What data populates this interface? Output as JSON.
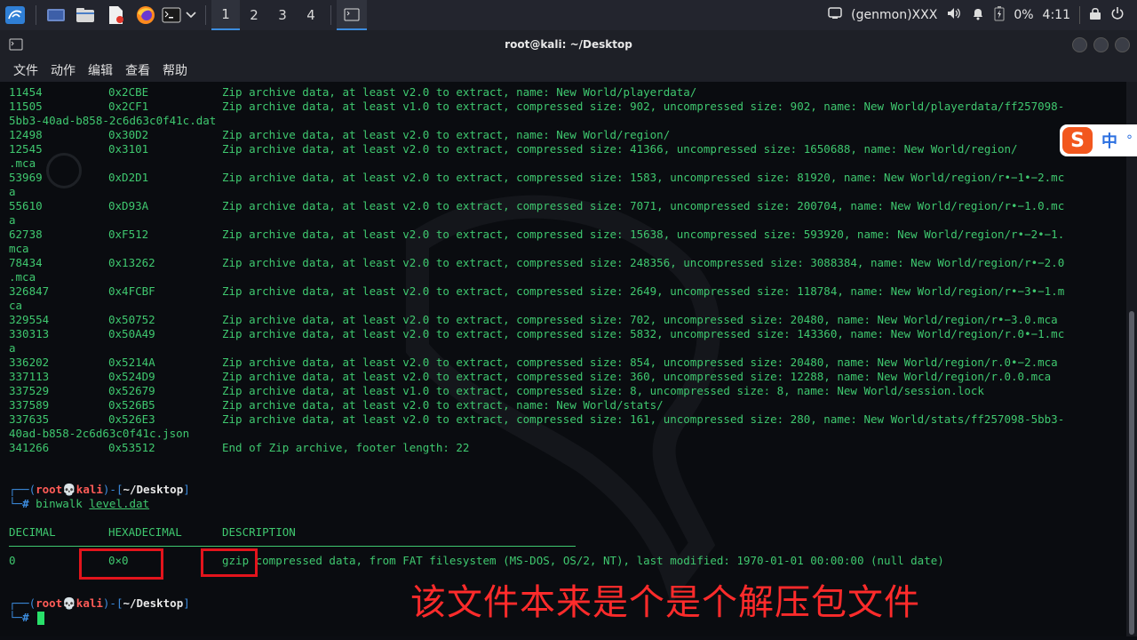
{
  "panel": {
    "workspaces": [
      "1",
      "2",
      "3",
      "4"
    ],
    "genmon": "(genmon)XXX",
    "battery": "0%",
    "clock": "4:11"
  },
  "window": {
    "title": "root@kali: ~/Desktop",
    "menu": [
      "文件",
      "动作",
      "编辑",
      "查看",
      "帮助"
    ]
  },
  "binwalk_rows": [
    {
      "dec": "11454",
      "hex": "0x2CBE",
      "desc": "Zip archive data, at least v2.0 to extract, name: New World/playerdata/"
    },
    {
      "dec": "11505",
      "hex": "0x2CF1",
      "desc": "Zip archive data, at least v1.0 to extract, compressed size: 902, uncompressed size: 902, name: New World/playerdata/ff257098-",
      "wrap": "5bb3-40ad-b858-2c6d63c0f41c.dat"
    },
    {
      "dec": "12498",
      "hex": "0x30D2",
      "desc": "Zip archive data, at least v2.0 to extract, name: New World/region/"
    },
    {
      "dec": "12545",
      "hex": "0x3101",
      "desc": "Zip archive data, at least v2.0 to extract, compressed size: 41366, uncompressed size: 1650688, name: New World/region/",
      "wrap": ".mca"
    },
    {
      "dec": "53969",
      "hex": "0xD2D1",
      "desc": "Zip archive data, at least v2.0 to extract, compressed size: 1583, uncompressed size: 81920, name: New World/region/r•−1•−2.mc",
      "wrap": "a"
    },
    {
      "dec": "55610",
      "hex": "0xD93A",
      "desc": "Zip archive data, at least v2.0 to extract, compressed size: 7071, uncompressed size: 200704, name: New World/region/r•−1.0.mc",
      "wrap": "a"
    },
    {
      "dec": "62738",
      "hex": "0xF512",
      "desc": "Zip archive data, at least v2.0 to extract, compressed size: 15638, uncompressed size: 593920, name: New World/region/r•−2•−1.",
      "wrap": "mca"
    },
    {
      "dec": "78434",
      "hex": "0x13262",
      "desc": "Zip archive data, at least v2.0 to extract, compressed size: 248356, uncompressed size: 3088384, name: New World/region/r•−2.0",
      "wrap": ".mca"
    },
    {
      "dec": "326847",
      "hex": "0x4FCBF",
      "desc": "Zip archive data, at least v2.0 to extract, compressed size: 2649, uncompressed size: 118784, name: New World/region/r•−3•−1.m",
      "wrap": "ca"
    },
    {
      "dec": "329554",
      "hex": "0x50752",
      "desc": "Zip archive data, at least v2.0 to extract, compressed size: 702, uncompressed size: 20480, name: New World/region/r•−3.0.mca"
    },
    {
      "dec": "330313",
      "hex": "0x50A49",
      "desc": "Zip archive data, at least v2.0 to extract, compressed size: 5832, uncompressed size: 143360, name: New World/region/r.0•−1.mc",
      "wrap": "a"
    },
    {
      "dec": "336202",
      "hex": "0x5214A",
      "desc": "Zip archive data, at least v2.0 to extract, compressed size: 854, uncompressed size: 20480, name: New World/region/r.0•−2.mca"
    },
    {
      "dec": "337113",
      "hex": "0x524D9",
      "desc": "Zip archive data, at least v2.0 to extract, compressed size: 360, uncompressed size: 12288, name: New World/region/r.0.0.mca"
    },
    {
      "dec": "337529",
      "hex": "0x52679",
      "desc": "Zip archive data, at least v1.0 to extract, compressed size: 8, uncompressed size: 8, name: New World/session.lock"
    },
    {
      "dec": "337589",
      "hex": "0x526B5",
      "desc": "Zip archive data, at least v2.0 to extract, name: New World/stats/"
    },
    {
      "dec": "337635",
      "hex": "0x526E3",
      "desc": "Zip archive data, at least v2.0 to extract, compressed size: 161, uncompressed size: 280, name: New World/stats/ff257098-5bb3-",
      "wrap": "40ad-b858-2c6d63c0f41c.json"
    },
    {
      "dec": "341266",
      "hex": "0x53512",
      "desc": "End of Zip archive, footer length: 22"
    }
  ],
  "prompt": {
    "user": "root",
    "host": "kali",
    "dir": "~/Desktop",
    "command": "binwalk",
    "arg": "level.dat"
  },
  "result": {
    "h_dec": "DECIMAL",
    "h_hex": "HEXADECIMAL",
    "h_desc": "DESCRIPTION",
    "dec": "0",
    "hex": "0×0",
    "desc_kw": "gzip",
    "desc_rest": " compressed data, from FAT filesystem (MS-DOS, OS/2, NT), last modified: 1970-01-01 00:00:00 (null date)"
  },
  "annotation": "该文件本来是个是个解压包文件",
  "ime": {
    "zh": "中"
  }
}
